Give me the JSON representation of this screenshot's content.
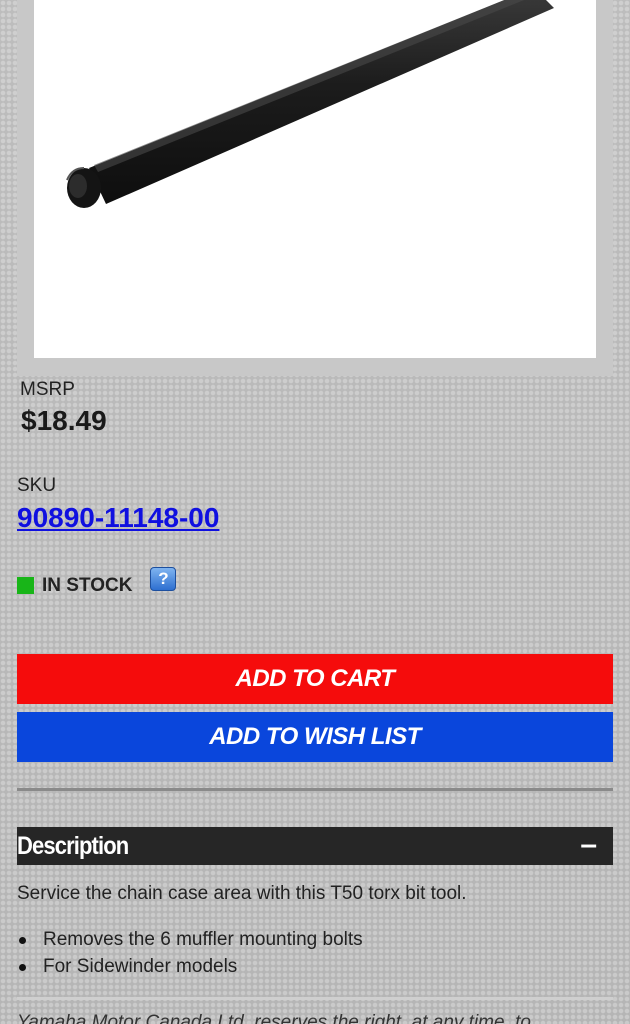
{
  "product": {
    "msrp_label": "MSRP",
    "price": "$18.49",
    "sku_label": "SKU",
    "sku": "90890-11148-00",
    "stock_status": "IN STOCK",
    "stock_color": "#18b518",
    "help_glyph": "?"
  },
  "actions": {
    "add_to_cart": "ADD TO CART",
    "add_to_wish_list": "ADD TO WISH LIST",
    "cart_color": "#f50c0c",
    "wish_color": "#0a46dc"
  },
  "description": {
    "title": "Description",
    "toggle_glyph": "–",
    "summary": "Service the chain case area with this T50 torx bit tool.",
    "features": [
      "Removes the 6 muffler mounting bolts",
      "For Sidewinder models"
    ],
    "disclaimer": "Yamaha Motor Canada Ltd. reserves the right, at any time, to"
  }
}
